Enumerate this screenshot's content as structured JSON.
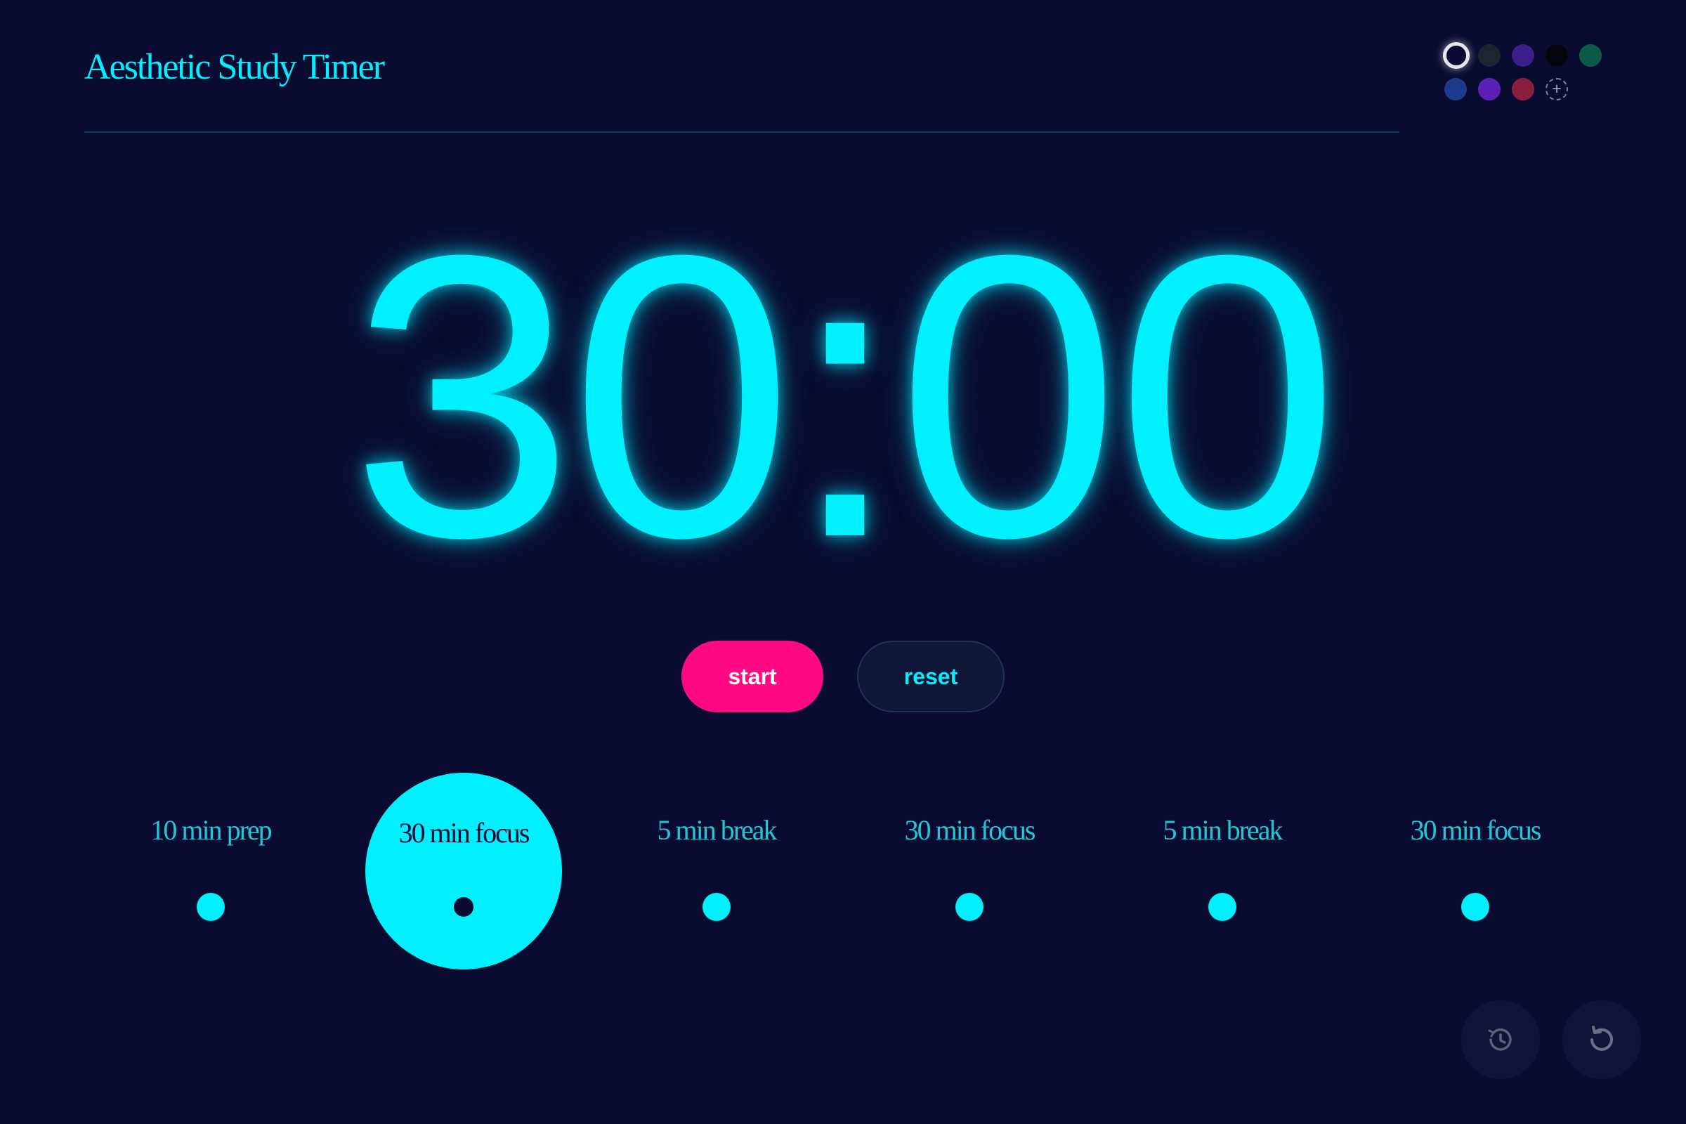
{
  "header": {
    "title": "Aesthetic Study Timer"
  },
  "themes": {
    "swatches": [
      {
        "name": "white-outline",
        "color": "#0a0b30",
        "selected": true
      },
      {
        "name": "dark-gray",
        "color": "#1e2430"
      },
      {
        "name": "indigo",
        "color": "#3a1e8a"
      },
      {
        "name": "black",
        "color": "#05050d"
      },
      {
        "name": "teal",
        "color": "#0d5a4a"
      },
      {
        "name": "navy-blue",
        "color": "#1e3a8a"
      },
      {
        "name": "violet",
        "color": "#5b21b6"
      },
      {
        "name": "crimson",
        "color": "#8a1e3e"
      },
      {
        "name": "custom",
        "color": "#0a0b30",
        "glyph": "+"
      }
    ]
  },
  "timer": {
    "display": "30:00"
  },
  "controls": {
    "start_label": "start",
    "reset_label": "reset"
  },
  "steps": [
    {
      "label": "10 min prep",
      "active": false
    },
    {
      "label": "30 min focus",
      "active": true
    },
    {
      "label": "5 min break",
      "active": false
    },
    {
      "label": "30 min focus",
      "active": false
    },
    {
      "label": "5 min break",
      "active": false
    },
    {
      "label": "30 min focus",
      "active": false
    }
  ],
  "corner_buttons": {
    "history_icon": "history-icon",
    "restart_icon": "restart-icon"
  },
  "colors": {
    "background": "#0a0b30",
    "accent": "#00f0ff",
    "start_button": "#ff0a84"
  }
}
